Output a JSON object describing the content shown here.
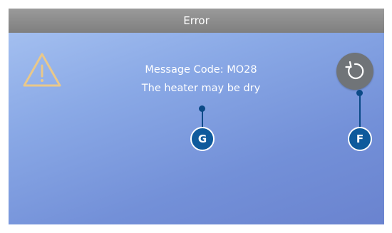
{
  "header": {
    "title": "Error"
  },
  "message": {
    "code_line": "Message Code: MO28",
    "description": "The heater may be dry"
  },
  "icons": {
    "warning": "warning-triangle-icon",
    "refresh": "refresh-icon"
  },
  "callouts": [
    {
      "label": "G"
    },
    {
      "label": "F"
    }
  ],
  "colors": {
    "warning": "#e9c88a",
    "callout": "#0e5a9c",
    "titlebar": "#8a8a8a",
    "refresh_button": "#707478"
  }
}
